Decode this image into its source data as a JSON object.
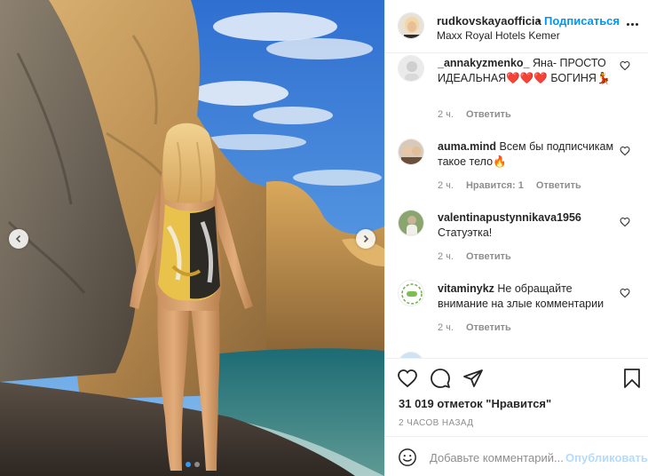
{
  "post": {
    "carousel_dots": 2,
    "active_dot": 0
  },
  "header": {
    "username": "rudkovskayaofficia",
    "separator": "•",
    "follow_label": "Подписаться",
    "location": "Maxx Royal Hotels Kemer"
  },
  "comments": [
    {
      "username": "_annakyzmenko_",
      "text": "Яна- ПРОСТО ИДЕАЛЬНАЯ❤️❤️❤️ БОГИНЯ💃",
      "time": "2 ч.",
      "likes": "",
      "reply_label": "Ответить"
    },
    {
      "username": "auma.mind",
      "text": "Всем бы подписчикам такое тело🔥",
      "time": "2 ч.",
      "likes": "Нравится: 1",
      "reply_label": "Ответить"
    },
    {
      "username": "valentinapustynnikava1956",
      "text": "Статуэтка!",
      "time": "2 ч.",
      "likes": "",
      "reply_label": "Ответить"
    },
    {
      "username": "vitaminykz",
      "text": "Не обращайте внимание на злые комментарии",
      "time": "2 ч.",
      "likes": "",
      "reply_label": "Ответить"
    }
  ],
  "stats": {
    "likes": "31 019 отметок \"Нравится\"",
    "posted": "2 часов назад"
  },
  "add_comment": {
    "placeholder": "Добавьте комментарий...",
    "publish_label": "Опубликовать"
  },
  "colors": {
    "accent": "#0095f6",
    "publish_disabled": "#b3dbff",
    "muted": "#8e8e8e",
    "text": "#262626"
  }
}
